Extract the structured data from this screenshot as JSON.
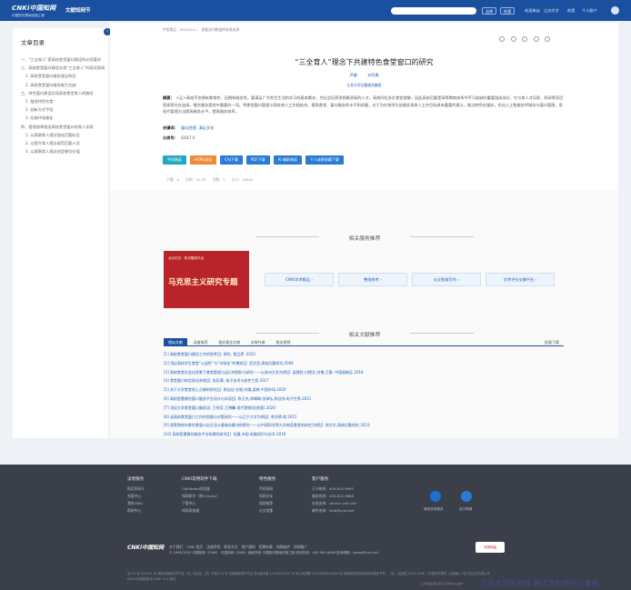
{
  "header": {
    "logo_text": "CNKi中国知网",
    "logo_sub": "中国知识基础设施工程",
    "brand": "文献知网节",
    "buttons": [
      "总库",
      "检索"
    ],
    "welcome": "欢迎来自",
    "org": "江苏大学",
    "account": "的您",
    "personal": "个人账户"
  },
  "sidebar": {
    "title": "文章目录",
    "items": [
      {
        "label": "一、“三全育人”是高校食堂窗口建设的必然要求",
        "level": 1
      },
      {
        "label": "二、高校食堂窗口建设实现“三全育人”的现实困境",
        "level": 1
      },
      {
        "label": "1. 高校食堂窗口服务理念陈旧",
        "level": 2
      },
      {
        "label": "2. 高校食堂窗口服务能力欠缺",
        "level": 2
      },
      {
        "label": "三、特色窗口建设实现高校食堂育人的路径",
        "level": 1
      },
      {
        "label": "1. 推进特色饮食",
        "level": 2
      },
      {
        "label": "2. 创新方式手段",
        "level": 2
      },
      {
        "label": "3. 实施环境美化",
        "level": 2
      },
      {
        "label": "四、管理改革推进高校食堂窗口的育人实践",
        "level": 1
      },
      {
        "label": "1. 以满意育人理念强化后勤队伍",
        "level": 2
      },
      {
        "label": "2. 以提升育人理念规范后勤人员",
        "level": 2
      },
      {
        "label": "3. 以满意育人理念创造餐饮价值",
        "level": 2
      }
    ]
  },
  "article": {
    "breadcrumb": "中国食品 . 2023(22) 。  查看该刊数据库收录来源",
    "title": "“三全育人”理念下共建特色食堂窗口的研究",
    "authors": [
      "尹璇",
      "许同勇"
    ],
    "org": "江苏大学后勤服务集团",
    "abstract_label": "摘要：",
    "abstract": "<正>高校不仅拥有教育性，还拥有服务性。要满足广大师生生活和学习的基本需求，为社会培养思想素质高的人才。高校同在多在食堂就餐，因此高校后勤是高等教育体系中不可或缺的重要组成部分，它与育人才培养、科研等项目是紧密在在连接。餐饮服务是其中重要的一项。将食堂窗口管理与高校育人工作相结合，提高食堂、窗口服务的水平和质量，对于为在校师生创建实现育人工作目标具有重要的意义。推动特色化服务，优化人工智能技术服务与窗口管理，用现代管理方法提高服务水平，提高服务效率。",
    "keywords_label": "关键词：",
    "keywords": "窗口经营; 满足文化",
    "class_label": "分类号：",
    "class_no": "G647.4",
    "buttons": [
      {
        "label": "手机阅读",
        "color": "#22a9c2"
      },
      {
        "label": "HTML阅读",
        "color": "#f08a35"
      },
      {
        "label": "CAJ下载",
        "color": "#2a7bd6"
      },
      {
        "label": "PDF下载",
        "color": "#2a7bd6"
      },
      {
        "label": "AI 辅助阅读",
        "color": "#2a7bd6"
      },
      {
        "label": "个人成果收藏下载",
        "color": "#2a7bd6"
      }
    ],
    "meta": [
      "下载：5",
      "页码：31-33",
      "页数：3",
      "大小：1592K"
    ]
  },
  "services": {
    "title": "相关服务推荐",
    "banner_sub": "北大中文 · 知识服务平台",
    "banner_title": "马克思主义研究专题",
    "items": [
      "CNKI学术精品 ›",
      "整理参考 ›",
      "论文智能写作 ›",
      "学术评价支撑平台 ›"
    ]
  },
  "references": {
    "title": "相关文献推荐",
    "tabs": [
      "相似文献",
      "读者推荐",
      "相关基金文献",
      "关联作者",
      "相关视频"
    ],
    "more": "批量下载",
    "items": [
      "[1] 高校食堂窗口建设工作的思考[J]. 郭东, 食品界 .2022",
      "[2] 浅议高校学生食堂“公益性”与“市场化”的博弈[J]. 武艾民,高校后勤研究.2006",
      "[3] 高校食堂社会化背景下食堂管理与运行的探析与研究——以苏州大学为例[J]. 梁建民,付德文,刘博,王静. 中国高新区.2018",
      "[4] 食堂窗口的信息化系统[J]. 张彭满 .电子技术与软件工程.2017",
      "[5] 关于大学食堂线上点餐的研究[J]. 陈佳佳 杜钢,刘璐,梁婷.中国市场.2020",
      "[6] 高校智慧餐饮窗口服务平台设计与实现[J]. 陈玉杰,李琳琳,张泽弘,陈佳伟.电子世界.2021",
      "[7] 浅议大学食堂窗口服务[J]. 王祥芳,王博馨.现代营销(信息版).2020",
      "[8] 谈高校食堂窗口工作的思路与对策研究——以辽宁大学为例[J]. 李文德.商.2015",
      "[9] 高等院校伙食饮食窗口自主设计基础化解决的探究——以中国科学院大学南苑食堂的研究为例[J]. 钟文华,高校后勤研究.2023",
      "[10] 高校智慧餐饮服务平台构建的研究[J]. 金健,韦韬.电脑知识与技术.2019"
    ]
  },
  "footer": {
    "cols": [
      {
        "head": "读者服务",
        "items": [
          "购买知网卡",
          "充值中心",
          "我的CNKI",
          "帮助中心"
        ]
      },
      {
        "head": "CNKI常用软件下载",
        "items": [
          "CAJViewer浏览器",
          "知网研学（原E-Study）",
          "下载中心",
          "知网表格通"
        ]
      },
      {
        "head": "特色服务",
        "items": [
          "手机知网",
          "知网文化",
          "知网推荐",
          "论文查重"
        ]
      },
      {
        "head": "客户服务",
        "items": [
          "订卡热线：400-819-9993",
          "服务热线：400-810-9888",
          "在线咨询：service.cnki.net",
          "邮件咨询：help@cnki.net"
        ]
      }
    ],
    "qr_labels": [
      "微信咨询服务",
      "官方微博"
    ],
    "links": [
      "关于我们",
      "CNKI 首页",
      "法律声明",
      "联系方式",
      "用户通知",
      "招聘启事",
      "知网维护",
      "知网推广"
    ],
    "copyright": "© 1998-2025 中国知网（CNKI） 中国知网（CNKI）版权所有 中国知识基础设施工程 咨询热线：400-962-8066 投诉邮箱：jubao@cnki.net",
    "badge": "中国网监",
    "legal": "京 ICP 证 040431 号  网络出版服务许可证（总）网出证（京）字第 271 号  出版物经营许可证 京出版字第 11018011007 号  京公网安备 11010802020460 号  互联网药品信息服务资格证书号：（京）-经营性-2017-0036\n《中国学术期刊（光盘版）》电子杂志社有限公司  KDN 平台基础技术 CNKI 13.0 提供"
  },
  "watermark": "江苏大学图书馆 要江苏智库中心发布",
  "watermark_small": "江苏省图书馆 要江苏智库中心发布"
}
